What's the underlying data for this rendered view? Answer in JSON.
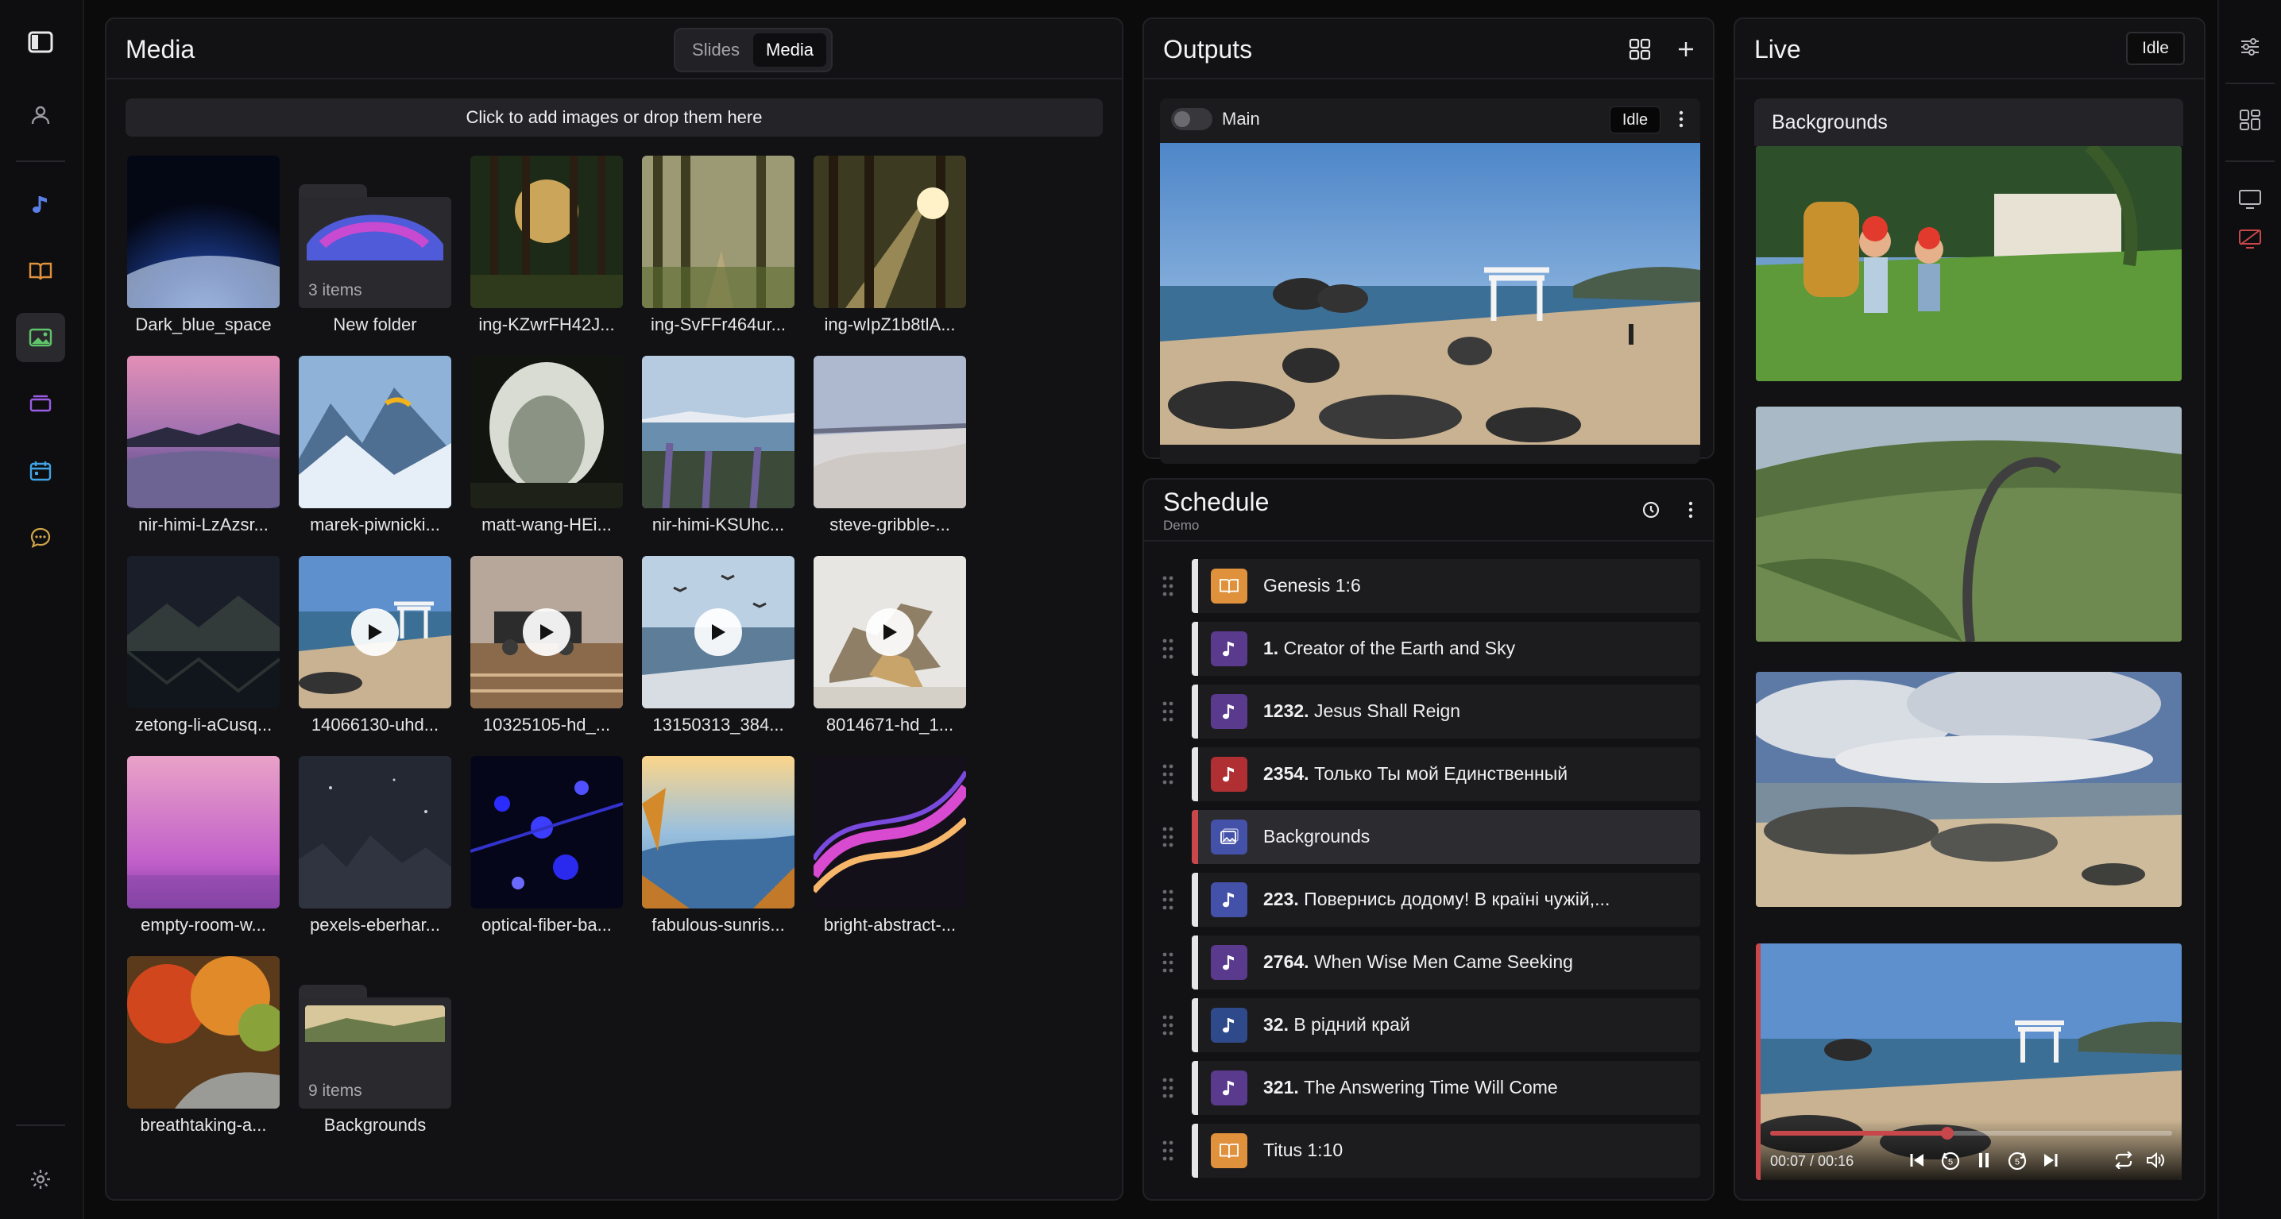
{
  "media": {
    "title": "Media",
    "tab_slides": "Slides",
    "tab_media": "Media",
    "dropzone": "Click to add images or drop them here",
    "items": [
      {
        "label": "Dark_blue_space",
        "kind": "image",
        "art": "space"
      },
      {
        "label": "New folder",
        "kind": "folder",
        "count": "3 items",
        "art": "folder-rainbow"
      },
      {
        "label": "ing-KZwrFH42J...",
        "kind": "image",
        "art": "forest-sun"
      },
      {
        "label": "ing-SvFFr464ur...",
        "kind": "image",
        "art": "forest-path"
      },
      {
        "label": "ing-wIpZ1b8tlA...",
        "kind": "image",
        "art": "forest-rays"
      },
      {
        "label": "nir-himi-LzAzsr...",
        "kind": "image",
        "art": "pink-clouds"
      },
      {
        "label": "marek-piwnicki...",
        "kind": "image",
        "art": "paraglider"
      },
      {
        "label": "matt-wang-HEi...",
        "kind": "image",
        "art": "cave"
      },
      {
        "label": "nir-himi-KSUhc...",
        "kind": "image",
        "art": "lake-flowers"
      },
      {
        "label": "steve-gribble-...",
        "kind": "image",
        "art": "dunes"
      },
      {
        "label": "zetong-li-aCusq...",
        "kind": "image",
        "art": "night-lake"
      },
      {
        "label": "14066130-uhd...",
        "kind": "video",
        "art": "torii"
      },
      {
        "label": "10325105-hd_...",
        "kind": "video",
        "art": "train-toy"
      },
      {
        "label": "13150313_384...",
        "kind": "video",
        "art": "sea-birds"
      },
      {
        "label": "8014671-hd_1...",
        "kind": "video",
        "art": "dinosaurs"
      },
      {
        "label": "empty-room-w...",
        "kind": "image",
        "art": "pink-room"
      },
      {
        "label": "pexels-eberhar...",
        "kind": "image",
        "art": "dark-rocks"
      },
      {
        "label": "optical-fiber-ba...",
        "kind": "image",
        "art": "fiber"
      },
      {
        "label": "fabulous-sunris...",
        "kind": "image",
        "art": "sunrise-lake"
      },
      {
        "label": "bright-abstract-...",
        "kind": "image",
        "art": "abstract"
      },
      {
        "label": "breathtaking-a...",
        "kind": "image",
        "art": "autumn"
      },
      {
        "label": "Backgrounds",
        "kind": "folder",
        "count": "9 items",
        "art": "folder-photo"
      }
    ]
  },
  "outputs": {
    "title": "Outputs",
    "output_name": "Main",
    "status": "Idle"
  },
  "schedule": {
    "title": "Schedule",
    "subtitle": "Demo",
    "items": [
      {
        "num": "",
        "title": "Genesis 1:6",
        "type": "book-icon",
        "color": "#e0913c",
        "selected": false
      },
      {
        "num": "1.",
        "title": "Creator of the Earth and Sky",
        "type": "music-note-icon",
        "color": "#5a3a8c",
        "selected": false
      },
      {
        "num": "1232.",
        "title": "Jesus Shall Reign",
        "type": "music-note-icon",
        "color": "#5a3a8c",
        "selected": false
      },
      {
        "num": "2354.",
        "title": "Только Ты мой Единственный",
        "type": "music-note-icon",
        "color": "#b02f33",
        "selected": false
      },
      {
        "num": "",
        "title": "Backgrounds",
        "type": "image-icon",
        "color": "#4451a8",
        "selected": true
      },
      {
        "num": "223.",
        "title": "Повернись додому! В країні чужій,...",
        "type": "music-note-icon",
        "color": "#4451a8",
        "selected": false
      },
      {
        "num": "2764.",
        "title": "When Wise Men Came Seeking",
        "type": "music-note-icon",
        "color": "#5a3a8c",
        "selected": false
      },
      {
        "num": "32.",
        "title": "В рідний край",
        "type": "music-note-icon",
        "color": "#2f4a8a",
        "selected": false
      },
      {
        "num": "321.",
        "title": "The Answering Time Will Come",
        "type": "music-note-icon",
        "color": "#5a3a8c",
        "selected": false
      },
      {
        "num": "",
        "title": "Titus 1:10",
        "type": "book-icon",
        "color": "#e0913c",
        "selected": false
      }
    ]
  },
  "live": {
    "title": "Live",
    "status": "Idle",
    "group_title": "Backgrounds",
    "video_time": "00:07 / 00:16",
    "video_progress": 0.44
  },
  "colors": {
    "accent_red": "#c8474b",
    "selected_bg": "#2c2c30"
  }
}
